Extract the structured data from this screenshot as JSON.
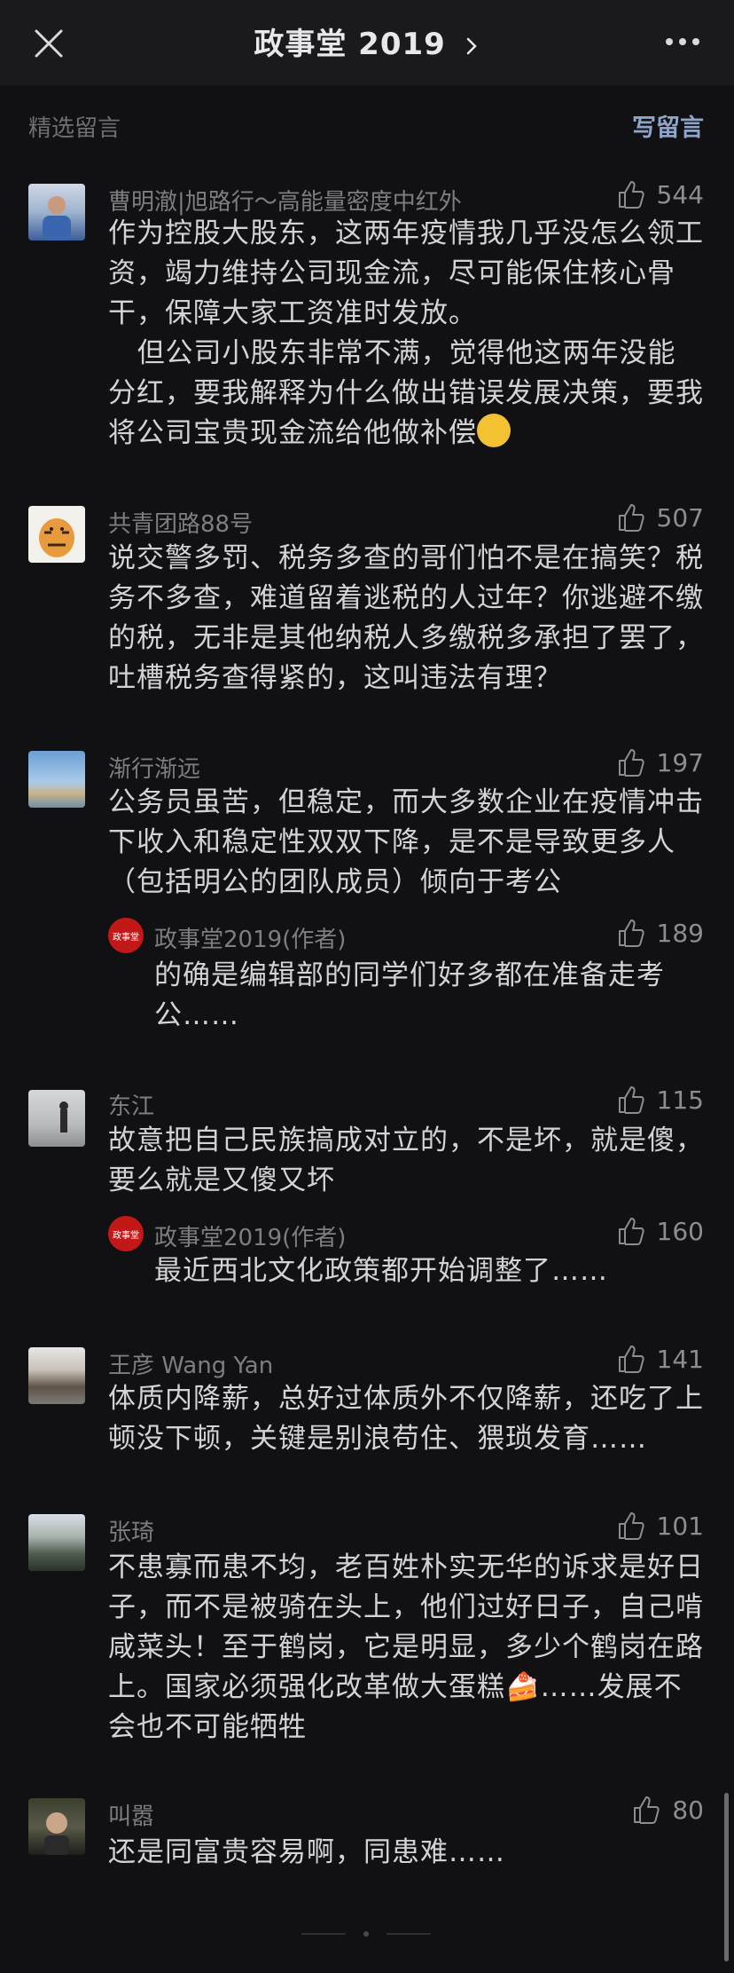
{
  "header": {
    "title": "政事堂 2019",
    "close_icon": "close-icon",
    "more_icon": "more-icon"
  },
  "section": {
    "label": "精选留言",
    "write": "写留言"
  },
  "comments": [
    {
      "name": "曹明澈|旭路行～高能量密度中红外",
      "likes": "544",
      "text": "作为控股大股东，这两年疫情我几乎没怎么领工资，竭力维持公司现金流，尽可能保住核心骨干，保障大家工资准时发放。\n   但公司小股东非常不满，觉得他这两年没能分红，要我解释为什么做出错误发展决策，要我将公司宝贵现金流给他做补偿"
    },
    {
      "name": "共青团路88号",
      "likes": "507",
      "text": "说交警多罚、税务多查的哥们怕不是在搞笑？税务不多查，难道留着逃税的人过年？你逃避不缴的税，无非是其他纳税人多缴税多承担了罢了，吐槽税务查得紧的，这叫违法有理？"
    },
    {
      "name": "渐行渐远",
      "likes": "197",
      "text": "公务员虽苦，但稳定，而大多数企业在疫情冲击下收入和稳定性双双下降，是不是导致更多人（包括明公的团队成员）倾向于考公",
      "reply": {
        "name": "政事堂2019(作者)",
        "likes": "189",
        "text": "的确是编辑部的同学们好多都在准备走考公……"
      }
    },
    {
      "name": "东江",
      "likes": "115",
      "text": "故意把自己民族搞成对立的，不是坏，就是傻，要么就是又傻又坏",
      "reply": {
        "name": "政事堂2019(作者)",
        "likes": "160",
        "text": "最近西北文化政策都开始调整了……"
      }
    },
    {
      "name": "王彦 Wang Yan",
      "likes": "141",
      "text": "体质内降薪，总好过体质外不仅降薪，还吃了上顿没下顿，关键是别浪苟住、猥琐发育……"
    },
    {
      "name": "张琦",
      "likes": "101",
      "text": "不患寡而患不均，老百姓朴实无华的诉求是好日子，而不是被骑在头上，他们过好日子，自己啃咸菜头！至于鹤岗，它是明显，多少个鹤岗在路上。国家必须强化改革做大蛋糕🍰……发展不会也不可能牺牲"
    },
    {
      "name": "叫嚣",
      "likes": "80",
      "text": "还是同富贵容易啊，同患难……"
    }
  ],
  "author_badge": "政事堂"
}
